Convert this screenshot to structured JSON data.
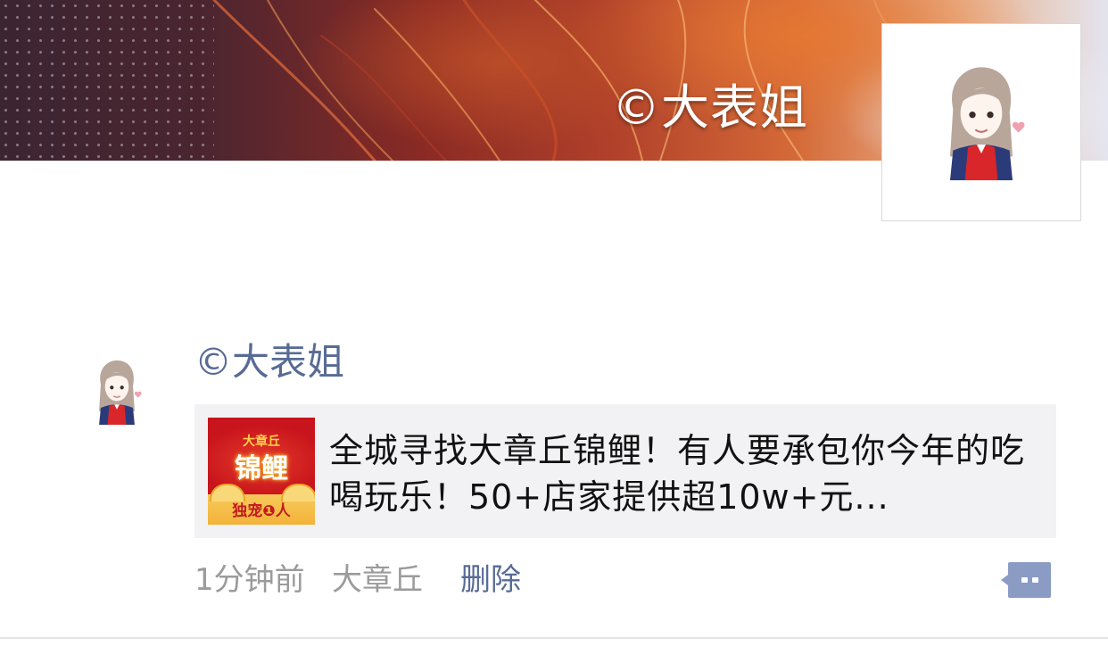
{
  "cover": {
    "watermark": "©大表姐"
  },
  "profile": {
    "avatar_icon": "cartoon-girl-avatar-icon"
  },
  "post": {
    "author": "©大表姐",
    "avatar_icon": "cartoon-girl-avatar-icon",
    "link": {
      "thumbnail_small_text": "大章丘",
      "thumbnail_big_text": "锦鲤",
      "thumbnail_foot_text": "独宠❶人",
      "title": "全城寻找大章丘锦鲤！有人要承包你今年的吃喝玩乐！50+店家提供超10w+元..."
    },
    "time": "1分钟前",
    "location": "大章丘",
    "delete_label": "删除",
    "comment_icon": "comment-bubble-icon"
  },
  "colors": {
    "link_blue": "#576b95",
    "meta_gray": "#9b9b9b",
    "card_bg": "#f2f2f4"
  }
}
